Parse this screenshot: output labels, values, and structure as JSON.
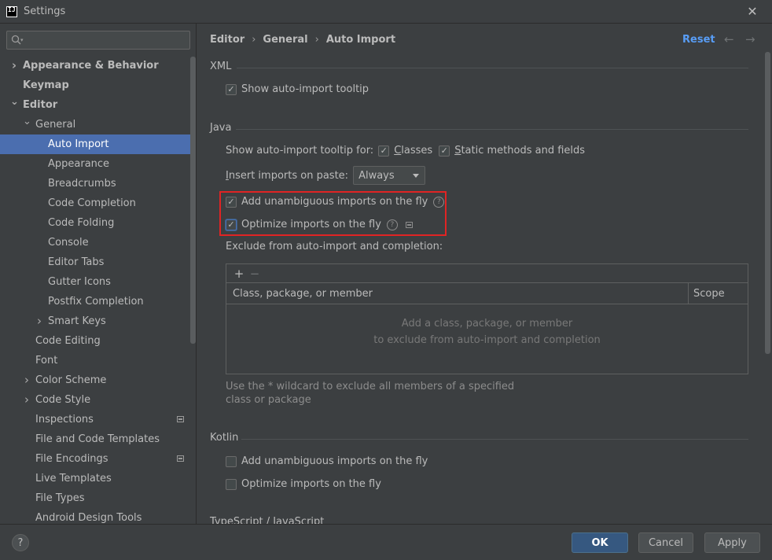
{
  "window": {
    "title": "Settings"
  },
  "search": {
    "placeholder": ""
  },
  "tree": [
    {
      "label": "Appearance & Behavior",
      "level": 0,
      "arrow": "right",
      "bold": true
    },
    {
      "label": "Keymap",
      "level": 0,
      "arrow": "",
      "bold": true
    },
    {
      "label": "Editor",
      "level": 0,
      "arrow": "down",
      "bold": true
    },
    {
      "label": "General",
      "level": 1,
      "arrow": "down"
    },
    {
      "label": "Auto Import",
      "level": 2,
      "arrow": "",
      "selected": true
    },
    {
      "label": "Appearance",
      "level": 2,
      "arrow": ""
    },
    {
      "label": "Breadcrumbs",
      "level": 2,
      "arrow": ""
    },
    {
      "label": "Code Completion",
      "level": 2,
      "arrow": ""
    },
    {
      "label": "Code Folding",
      "level": 2,
      "arrow": ""
    },
    {
      "label": "Console",
      "level": 2,
      "arrow": ""
    },
    {
      "label": "Editor Tabs",
      "level": 2,
      "arrow": ""
    },
    {
      "label": "Gutter Icons",
      "level": 2,
      "arrow": ""
    },
    {
      "label": "Postfix Completion",
      "level": 2,
      "arrow": ""
    },
    {
      "label": "Smart Keys",
      "level": 2,
      "arrow": "right"
    },
    {
      "label": "Code Editing",
      "level": 1,
      "arrow": ""
    },
    {
      "label": "Font",
      "level": 1,
      "arrow": ""
    },
    {
      "label": "Color Scheme",
      "level": 1,
      "arrow": "right"
    },
    {
      "label": "Code Style",
      "level": 1,
      "arrow": "right"
    },
    {
      "label": "Inspections",
      "level": 1,
      "arrow": "",
      "marker": true
    },
    {
      "label": "File and Code Templates",
      "level": 1,
      "arrow": ""
    },
    {
      "label": "File Encodings",
      "level": 1,
      "arrow": "",
      "marker": true
    },
    {
      "label": "Live Templates",
      "level": 1,
      "arrow": ""
    },
    {
      "label": "File Types",
      "level": 1,
      "arrow": ""
    },
    {
      "label": "Android Design Tools",
      "level": 1,
      "arrow": ""
    }
  ],
  "breadcrumb": {
    "part1": "Editor",
    "part2": "General",
    "part3": "Auto Import",
    "sep": "›"
  },
  "header": {
    "reset": "Reset",
    "back": "←",
    "forward": "→"
  },
  "xml": {
    "title": "XML",
    "show_tooltip": {
      "label": "Show auto-import tooltip",
      "checked": true
    }
  },
  "java": {
    "title": "Java",
    "tooltip_for": "Show auto-import tooltip for:",
    "classes": {
      "label": "Classes",
      "checked": true
    },
    "static": {
      "label": "Static methods and fields",
      "checked": true
    },
    "insert_label": "Insert imports on paste:",
    "insert_value": "Always",
    "add_unambiguous": {
      "label": "Add unambiguous imports on the fly",
      "checked": true
    },
    "optimize": {
      "label": "Optimize imports on the fly",
      "checked": true
    },
    "exclude_label": "Exclude from auto-import and completion:",
    "table": {
      "add": "+",
      "remove": "−",
      "col1": "Class, package, or member",
      "col2": "Scope",
      "empty_line1": "Add a class, package, or member",
      "empty_line2": "to exclude from auto-import and completion"
    },
    "hint": "Use the * wildcard to exclude all members of a specified class or package"
  },
  "kotlin": {
    "title": "Kotlin",
    "add_unambiguous": {
      "label": "Add unambiguous imports on the fly",
      "checked": false
    },
    "optimize": {
      "label": "Optimize imports on the fly",
      "checked": false
    }
  },
  "next_section": {
    "title": "TypeScript / JavaScript"
  },
  "footer": {
    "help": "?",
    "ok": "OK",
    "cancel": "Cancel",
    "apply": "Apply"
  },
  "colors": {
    "accent": "#4b6eaf",
    "link": "#589df6",
    "highlight": "#e02424"
  },
  "check_glyph": "✓"
}
